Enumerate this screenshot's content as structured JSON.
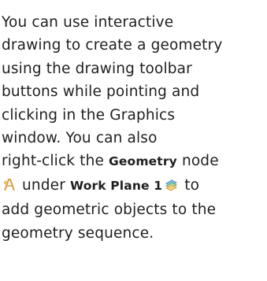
{
  "help_text": {
    "line1": "You can use interactive",
    "line2": "drawing to create a geometry",
    "line3": "using the drawing toolbar",
    "line4": "buttons while pointing and",
    "line5": "clicking in the Graphics",
    "line6": "window. You can also",
    "line7_before": "right-click the ",
    "geometry_node": "Geometry",
    "line7_after": " node",
    "line8_under": " under ",
    "work_plane_node": "Work Plane 1",
    "line8_after": " to",
    "line9": "add geometric objects to the",
    "line10": "geometry sequence."
  },
  "icons": {
    "geometry_node_icon": "geometry-node-icon",
    "work_plane_icon": "work-plane-icon"
  },
  "colors": {
    "text": "#1f1f1f",
    "icon_accent": "#d9a441",
    "icon_blue": "#4f90c9",
    "icon_green": "#5cae6e"
  }
}
